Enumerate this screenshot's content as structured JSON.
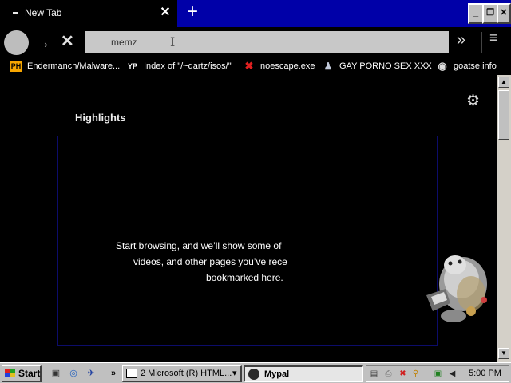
{
  "browser": {
    "tab": {
      "title": "New Tab",
      "close": "✕"
    },
    "new_tab": "+",
    "window_controls": {
      "minimize": "_",
      "restore": "❐",
      "close": "✕"
    },
    "nav": {
      "forward": "→",
      "stop": "✕",
      "overflow": "»",
      "menu": "≡"
    },
    "urlbar": {
      "value": "memz"
    },
    "bookmarks": [
      {
        "label": "Endermanch/Malware...",
        "icon": "PH",
        "icon_name": "pornhub-favicon-icon"
      },
      {
        "label": "Index of \"/~dartz/isos/\"",
        "icon": "YP",
        "icon_name": "yp-favicon-icon"
      },
      {
        "label": "noescape.exe",
        "icon": "✖",
        "icon_name": "red-x-favicon-icon"
      },
      {
        "label": "GAY PORNO SEX XXX",
        "icon": "♟",
        "icon_name": "site-favicon-icon"
      },
      {
        "label": "goatse.info",
        "icon": "◉",
        "icon_name": "globe-favicon-icon"
      }
    ]
  },
  "content": {
    "settings_icon": "⚙",
    "highlights_title": "Highlights",
    "message_lines": [
      "Start browsing, and we’ll show some of",
      "videos, and other pages you’ve rece",
      "bookmarked here."
    ]
  },
  "taskbar": {
    "start_label": "Start",
    "tasks": [
      {
        "label": "2 Microsoft (R) HTML...",
        "dropdown": "▾"
      },
      {
        "label": "Mypal"
      }
    ],
    "quicklaunch_more": "»",
    "clock": "5:00 PM"
  },
  "colors": {
    "titlebar": "#0000a8",
    "tab": "#000000",
    "urlbar": "#c8c8c8",
    "highlight_border": "#0c0c6a",
    "taskbar": "#c0c0c0"
  }
}
